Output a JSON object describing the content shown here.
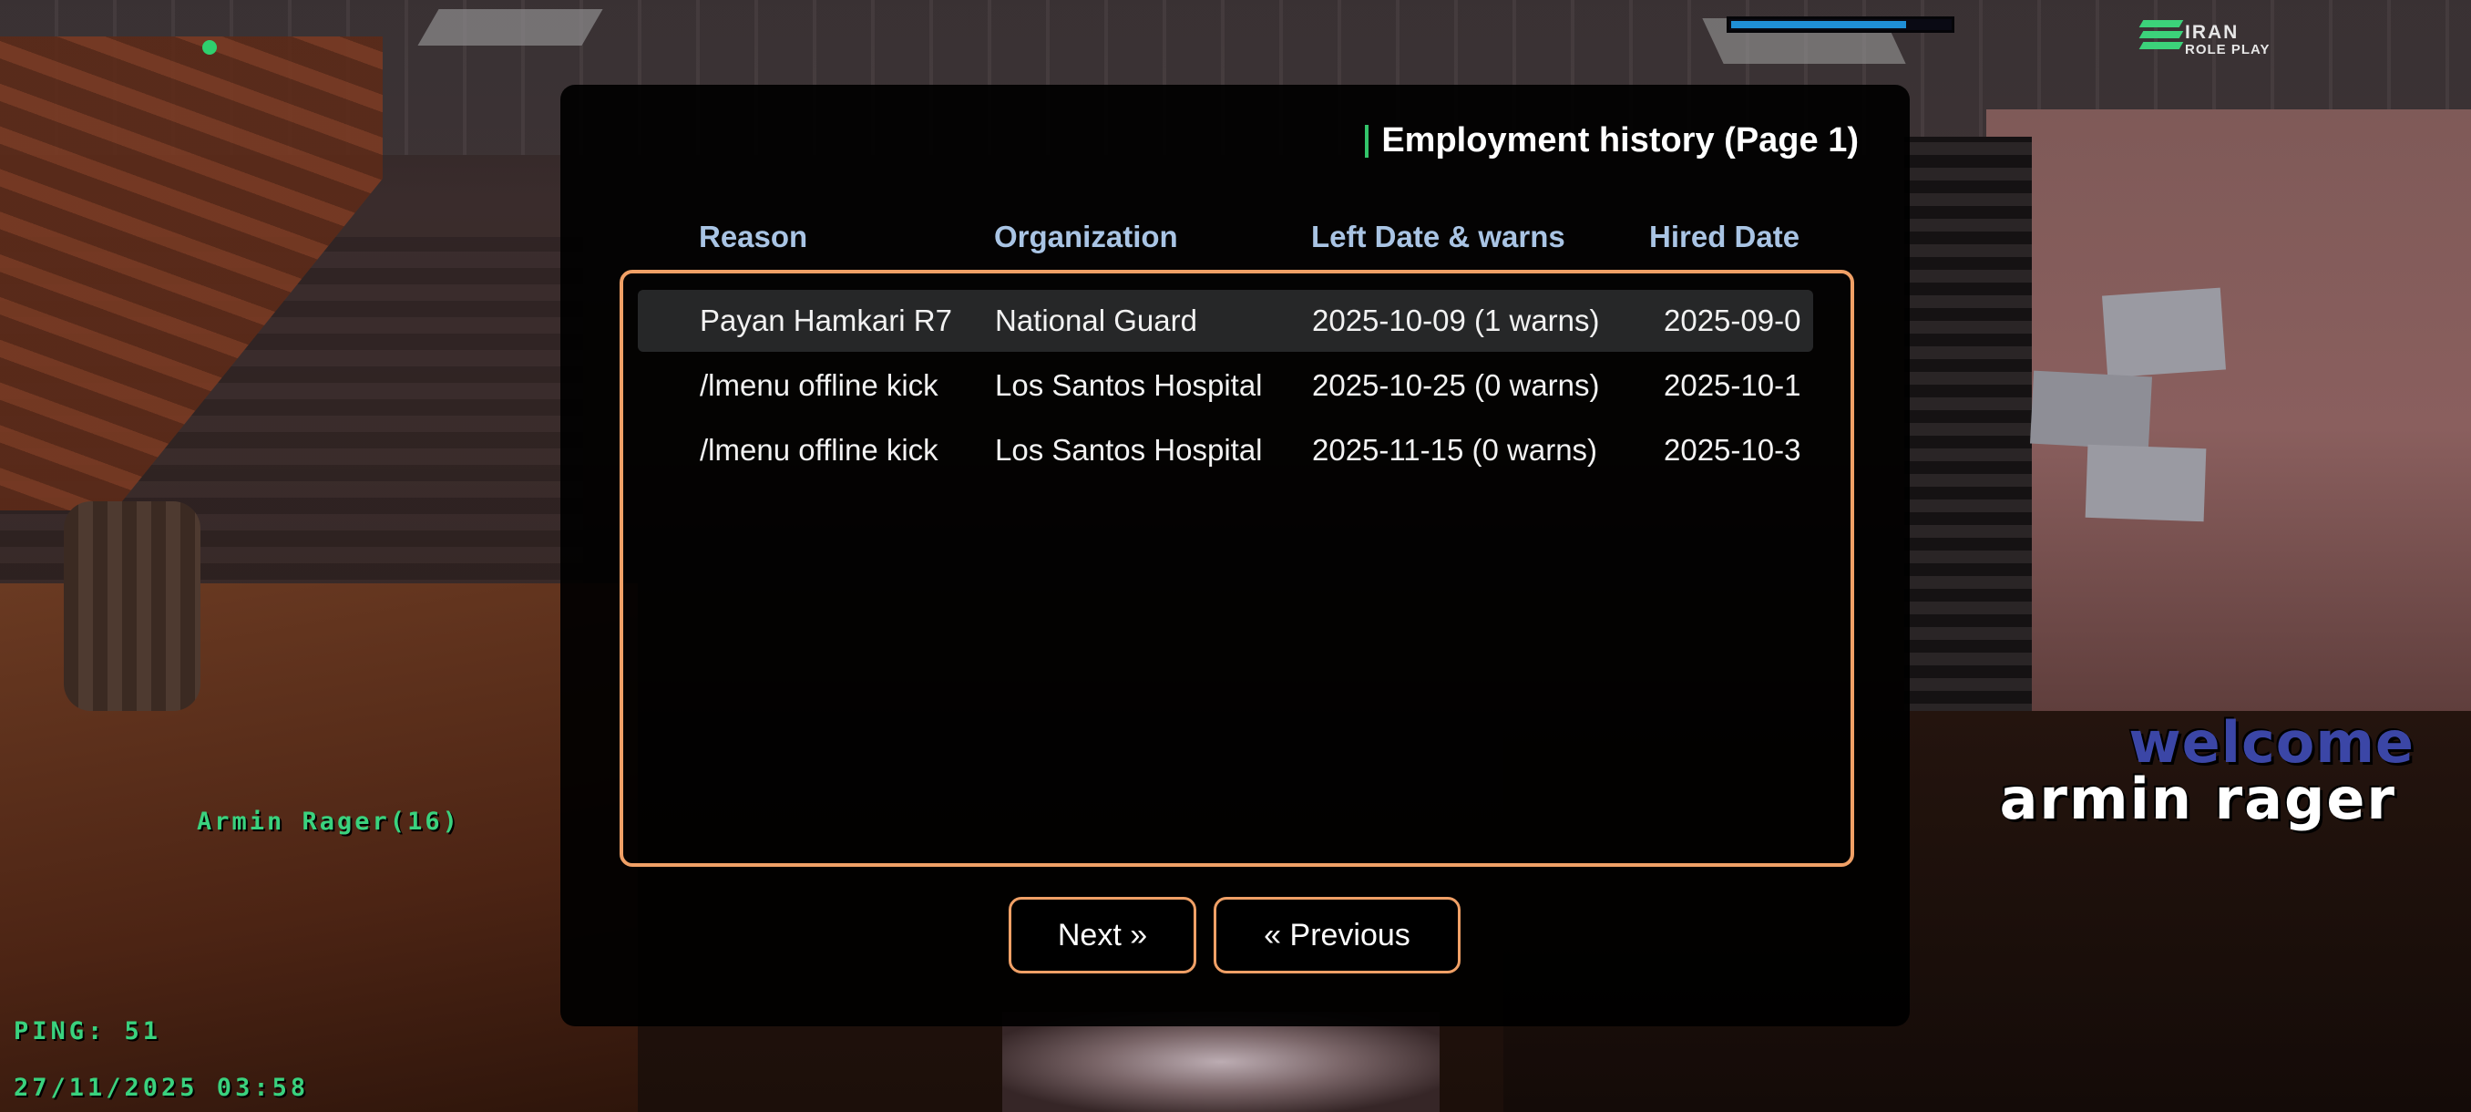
{
  "hud": {
    "brand_line1": "IRAN",
    "brand_line2": "ROLE PLAY",
    "health_fraction": 0.8,
    "player_tag": "Armin Rager(16)",
    "ping": "PING: 51",
    "datetime": "27/11/2025 03:58",
    "welcome": "welcome",
    "welcome_name": "armin rager"
  },
  "dialog": {
    "title": "Employment history (Page 1)",
    "columns": [
      "Reason",
      "Organization",
      "Left Date & warns",
      "Hired Date"
    ],
    "rows": [
      {
        "reason": "Payan Hamkari R7",
        "organization": "National Guard",
        "left": "2025-10-09 (1 warns)",
        "hired": "2025-09-0"
      },
      {
        "reason": "/lmenu offline kick",
        "organization": "Los Santos Hospital",
        "left": "2025-10-25 (0 warns)",
        "hired": "2025-10-1"
      },
      {
        "reason": "/lmenu offline kick",
        "organization": "Los Santos Hospital",
        "left": "2025-11-15 (0 warns)",
        "hired": "2025-10-3"
      }
    ],
    "selected_row": 0,
    "next_label": "Next »",
    "prev_label": "« Previous"
  },
  "colors": {
    "accent_border": "#f0a066",
    "header_text": "#a9c4e4",
    "title_bar": "#33c46a",
    "hud_green": "#3ad27e"
  }
}
